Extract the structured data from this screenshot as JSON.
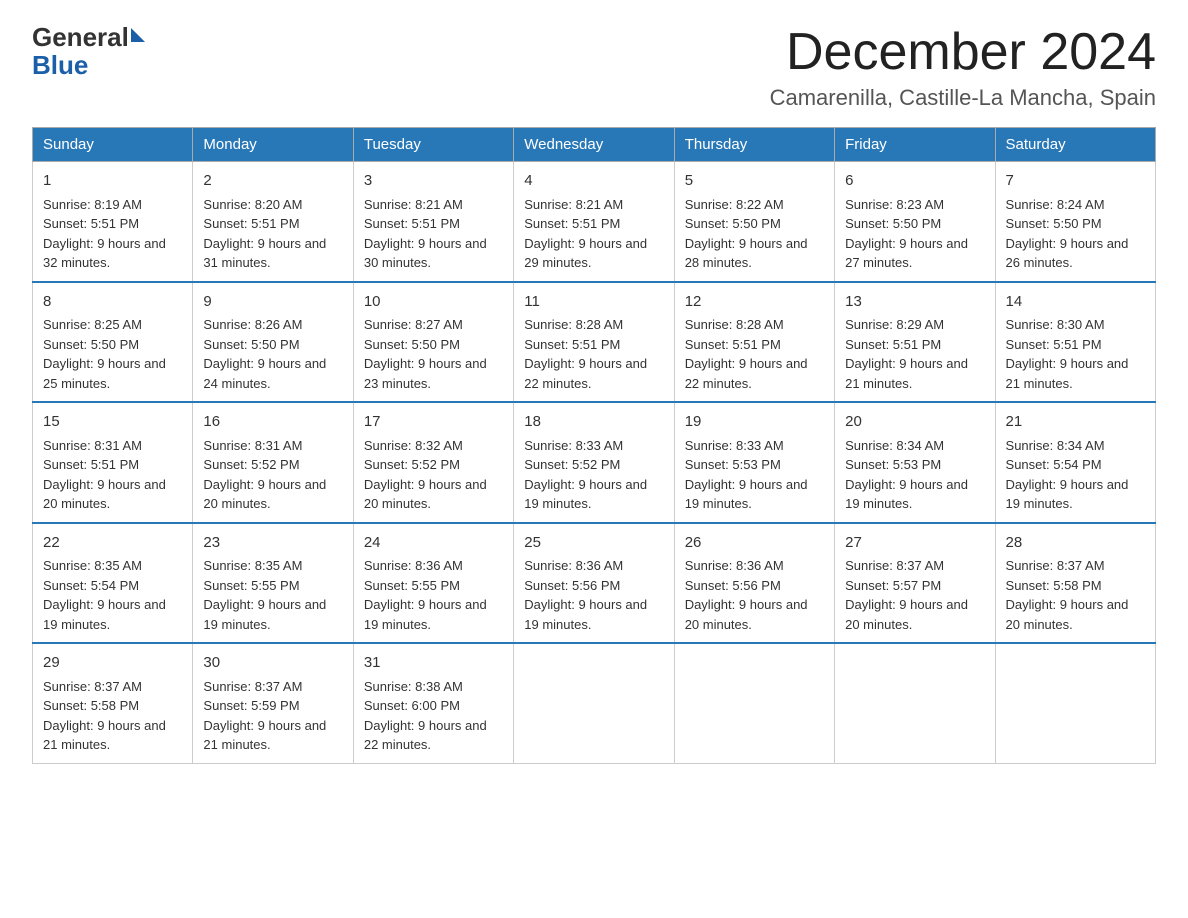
{
  "logo": {
    "general": "General",
    "blue": "Blue"
  },
  "title": "December 2024",
  "location": "Camarenilla, Castille-La Mancha, Spain",
  "days_of_week": [
    "Sunday",
    "Monday",
    "Tuesday",
    "Wednesday",
    "Thursday",
    "Friday",
    "Saturday"
  ],
  "weeks": [
    [
      {
        "day": "1",
        "sunrise": "Sunrise: 8:19 AM",
        "sunset": "Sunset: 5:51 PM",
        "daylight": "Daylight: 9 hours and 32 minutes."
      },
      {
        "day": "2",
        "sunrise": "Sunrise: 8:20 AM",
        "sunset": "Sunset: 5:51 PM",
        "daylight": "Daylight: 9 hours and 31 minutes."
      },
      {
        "day": "3",
        "sunrise": "Sunrise: 8:21 AM",
        "sunset": "Sunset: 5:51 PM",
        "daylight": "Daylight: 9 hours and 30 minutes."
      },
      {
        "day": "4",
        "sunrise": "Sunrise: 8:21 AM",
        "sunset": "Sunset: 5:51 PM",
        "daylight": "Daylight: 9 hours and 29 minutes."
      },
      {
        "day": "5",
        "sunrise": "Sunrise: 8:22 AM",
        "sunset": "Sunset: 5:50 PM",
        "daylight": "Daylight: 9 hours and 28 minutes."
      },
      {
        "day": "6",
        "sunrise": "Sunrise: 8:23 AM",
        "sunset": "Sunset: 5:50 PM",
        "daylight": "Daylight: 9 hours and 27 minutes."
      },
      {
        "day": "7",
        "sunrise": "Sunrise: 8:24 AM",
        "sunset": "Sunset: 5:50 PM",
        "daylight": "Daylight: 9 hours and 26 minutes."
      }
    ],
    [
      {
        "day": "8",
        "sunrise": "Sunrise: 8:25 AM",
        "sunset": "Sunset: 5:50 PM",
        "daylight": "Daylight: 9 hours and 25 minutes."
      },
      {
        "day": "9",
        "sunrise": "Sunrise: 8:26 AM",
        "sunset": "Sunset: 5:50 PM",
        "daylight": "Daylight: 9 hours and 24 minutes."
      },
      {
        "day": "10",
        "sunrise": "Sunrise: 8:27 AM",
        "sunset": "Sunset: 5:50 PM",
        "daylight": "Daylight: 9 hours and 23 minutes."
      },
      {
        "day": "11",
        "sunrise": "Sunrise: 8:28 AM",
        "sunset": "Sunset: 5:51 PM",
        "daylight": "Daylight: 9 hours and 22 minutes."
      },
      {
        "day": "12",
        "sunrise": "Sunrise: 8:28 AM",
        "sunset": "Sunset: 5:51 PM",
        "daylight": "Daylight: 9 hours and 22 minutes."
      },
      {
        "day": "13",
        "sunrise": "Sunrise: 8:29 AM",
        "sunset": "Sunset: 5:51 PM",
        "daylight": "Daylight: 9 hours and 21 minutes."
      },
      {
        "day": "14",
        "sunrise": "Sunrise: 8:30 AM",
        "sunset": "Sunset: 5:51 PM",
        "daylight": "Daylight: 9 hours and 21 minutes."
      }
    ],
    [
      {
        "day": "15",
        "sunrise": "Sunrise: 8:31 AM",
        "sunset": "Sunset: 5:51 PM",
        "daylight": "Daylight: 9 hours and 20 minutes."
      },
      {
        "day": "16",
        "sunrise": "Sunrise: 8:31 AM",
        "sunset": "Sunset: 5:52 PM",
        "daylight": "Daylight: 9 hours and 20 minutes."
      },
      {
        "day": "17",
        "sunrise": "Sunrise: 8:32 AM",
        "sunset": "Sunset: 5:52 PM",
        "daylight": "Daylight: 9 hours and 20 minutes."
      },
      {
        "day": "18",
        "sunrise": "Sunrise: 8:33 AM",
        "sunset": "Sunset: 5:52 PM",
        "daylight": "Daylight: 9 hours and 19 minutes."
      },
      {
        "day": "19",
        "sunrise": "Sunrise: 8:33 AM",
        "sunset": "Sunset: 5:53 PM",
        "daylight": "Daylight: 9 hours and 19 minutes."
      },
      {
        "day": "20",
        "sunrise": "Sunrise: 8:34 AM",
        "sunset": "Sunset: 5:53 PM",
        "daylight": "Daylight: 9 hours and 19 minutes."
      },
      {
        "day": "21",
        "sunrise": "Sunrise: 8:34 AM",
        "sunset": "Sunset: 5:54 PM",
        "daylight": "Daylight: 9 hours and 19 minutes."
      }
    ],
    [
      {
        "day": "22",
        "sunrise": "Sunrise: 8:35 AM",
        "sunset": "Sunset: 5:54 PM",
        "daylight": "Daylight: 9 hours and 19 minutes."
      },
      {
        "day": "23",
        "sunrise": "Sunrise: 8:35 AM",
        "sunset": "Sunset: 5:55 PM",
        "daylight": "Daylight: 9 hours and 19 minutes."
      },
      {
        "day": "24",
        "sunrise": "Sunrise: 8:36 AM",
        "sunset": "Sunset: 5:55 PM",
        "daylight": "Daylight: 9 hours and 19 minutes."
      },
      {
        "day": "25",
        "sunrise": "Sunrise: 8:36 AM",
        "sunset": "Sunset: 5:56 PM",
        "daylight": "Daylight: 9 hours and 19 minutes."
      },
      {
        "day": "26",
        "sunrise": "Sunrise: 8:36 AM",
        "sunset": "Sunset: 5:56 PM",
        "daylight": "Daylight: 9 hours and 20 minutes."
      },
      {
        "day": "27",
        "sunrise": "Sunrise: 8:37 AM",
        "sunset": "Sunset: 5:57 PM",
        "daylight": "Daylight: 9 hours and 20 minutes."
      },
      {
        "day": "28",
        "sunrise": "Sunrise: 8:37 AM",
        "sunset": "Sunset: 5:58 PM",
        "daylight": "Daylight: 9 hours and 20 minutes."
      }
    ],
    [
      {
        "day": "29",
        "sunrise": "Sunrise: 8:37 AM",
        "sunset": "Sunset: 5:58 PM",
        "daylight": "Daylight: 9 hours and 21 minutes."
      },
      {
        "day": "30",
        "sunrise": "Sunrise: 8:37 AM",
        "sunset": "Sunset: 5:59 PM",
        "daylight": "Daylight: 9 hours and 21 minutes."
      },
      {
        "day": "31",
        "sunrise": "Sunrise: 8:38 AM",
        "sunset": "Sunset: 6:00 PM",
        "daylight": "Daylight: 9 hours and 22 minutes."
      },
      null,
      null,
      null,
      null
    ]
  ]
}
